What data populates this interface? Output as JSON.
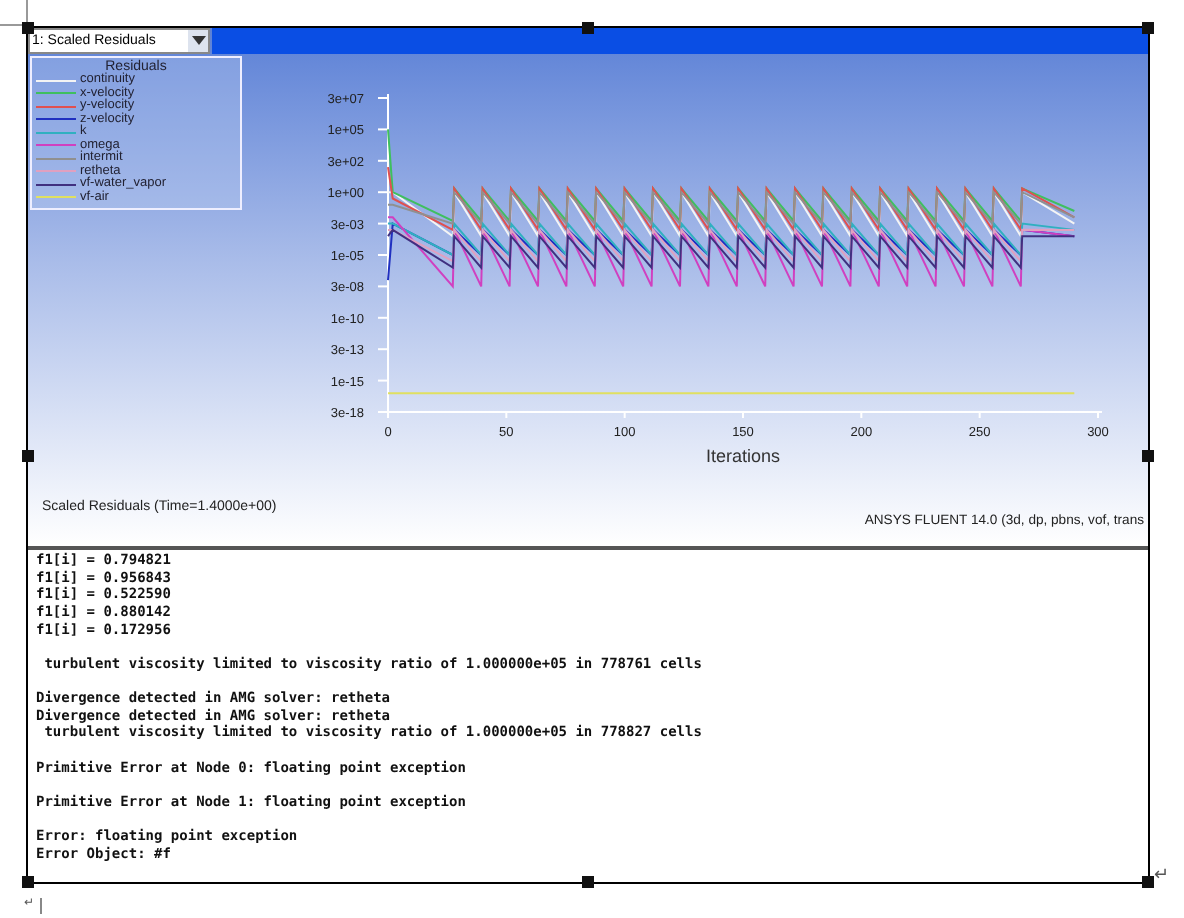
{
  "residuals_panel": {
    "dropdown": {
      "value": "1: Scaled Residuals"
    },
    "plot": {
      "legend_title": "Residuals",
      "legend": [
        {
          "name": "continuity",
          "color": "#f4f4f4"
        },
        {
          "name": "x-velocity",
          "color": "#3fbf5f"
        },
        {
          "name": "y-velocity",
          "color": "#e05050"
        },
        {
          "name": "z-velocity",
          "color": "#2030c0"
        },
        {
          "name": "k",
          "color": "#30b0c0"
        },
        {
          "name": "omega",
          "color": "#d040c0"
        },
        {
          "name": "intermit",
          "color": "#909090"
        },
        {
          "name": "retheta",
          "color": "#e0a0c0"
        },
        {
          "name": "vf-water_vapor",
          "color": "#403080"
        },
        {
          "name": "vf-air",
          "color": "#e0e060"
        }
      ],
      "y_tick_labels": [
        "3e+07",
        "1e+05",
        "3e+02",
        "1e+00",
        "3e-03",
        "1e-05",
        "3e-08",
        "1e-10",
        "3e-13",
        "1e-15",
        "3e-18"
      ],
      "x_tick_labels": [
        "0",
        "50",
        "100",
        "150",
        "200",
        "250",
        "300"
      ],
      "xlabel": "Iterations"
    },
    "caption": "Scaled Residuals  (Time=1.4000e+00)",
    "version": "ANSYS FLUENT 14.0 (3d, dp, pbns, vof, trans"
  },
  "console": {
    "blocks": [
      [
        "f1[i] = 0.794821",
        "f1[i] = 0.956843",
        "f1[i] = 0.522590",
        "f1[i] = 0.880142",
        "f1[i] = 0.172956"
      ],
      [
        " turbulent viscosity limited to viscosity ratio of 1.000000e+05 in 778761 cells"
      ],
      [
        "Divergence detected in AMG solver: retheta",
        "Divergence detected in AMG solver: retheta",
        " turbulent viscosity limited to viscosity ratio of 1.000000e+05 in 778827 cells"
      ],
      [
        "Primitive Error at Node 0: floating point exception"
      ],
      [
        "Primitive Error at Node 1: floating point exception"
      ],
      [
        "Error: floating point exception",
        "Error Object: #f"
      ]
    ]
  },
  "paragraph_marks": [
    "↵",
    "↵"
  ]
}
